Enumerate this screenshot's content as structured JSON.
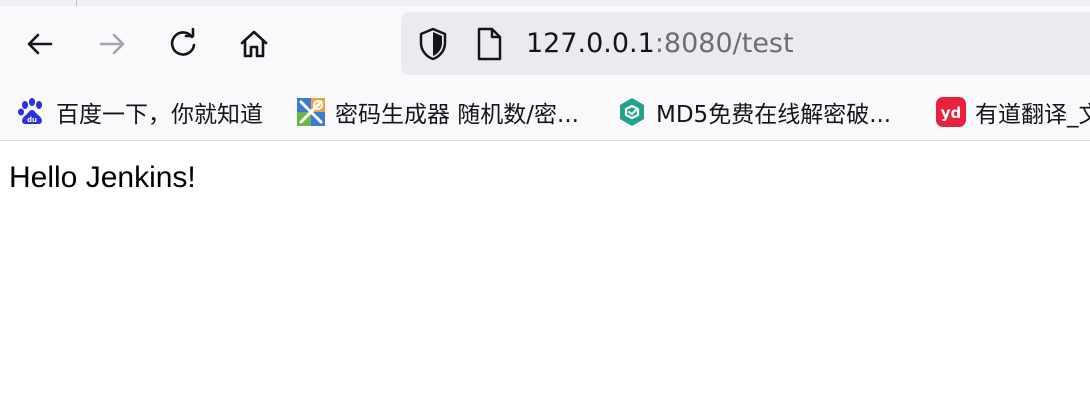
{
  "colors": {
    "chrome_bg": "#f9f9fb",
    "urlbar_bg": "#ebebef",
    "text": "#15141a",
    "muted_text": "#6d6d75",
    "disabled_icon": "#a5a5ab"
  },
  "navigation": {
    "back_icon": "back-arrow-icon",
    "forward_icon": "forward-arrow-icon",
    "reload_icon": "reload-icon",
    "home_icon": "home-icon"
  },
  "urlbar": {
    "host": "127.0.0.1",
    "rest": ":8080/test",
    "security_icon": "shield-icon",
    "page_icon": "page-icon"
  },
  "bookmarks": [
    {
      "label": "百度一下，你就知道",
      "icon": "baidu-icon"
    },
    {
      "label": "密码生成器 随机数/密...",
      "icon": "password-generator-icon"
    },
    {
      "label": "MD5免费在线解密破...",
      "icon": "md5-icon"
    },
    {
      "label": "有道翻译_文",
      "icon": "youdao-icon"
    }
  ],
  "page": {
    "text": "Hello Jenkins!"
  }
}
